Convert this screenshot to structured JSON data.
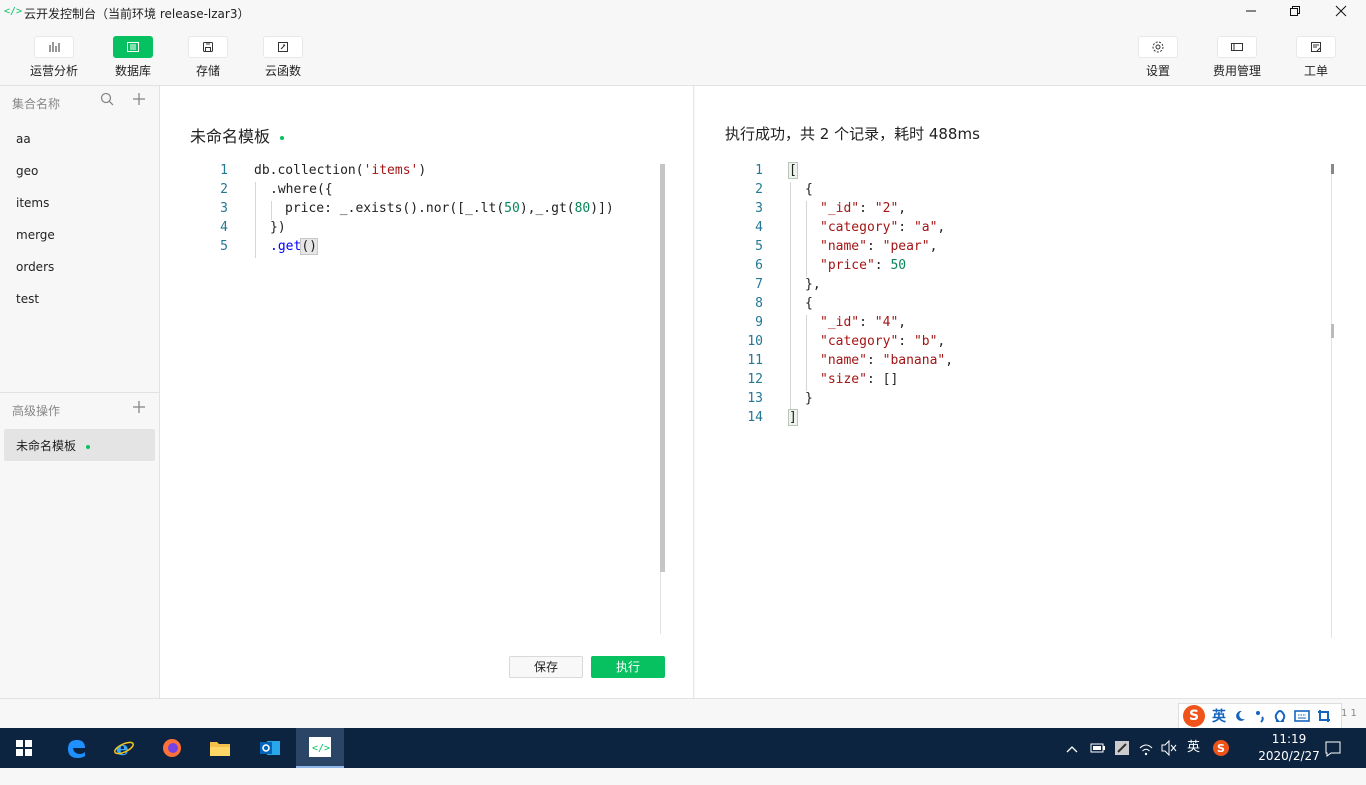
{
  "window": {
    "title": "云开发控制台（当前环境 release-lzar3）",
    "app_icon": "</>"
  },
  "toolbar": {
    "left": [
      {
        "label": "运营分析",
        "icon": "bar-chart-icon"
      },
      {
        "label": "数据库",
        "icon": "database-icon",
        "active": true
      },
      {
        "label": "存储",
        "icon": "storage-icon"
      },
      {
        "label": "云函数",
        "icon": "cloud-function-icon"
      }
    ],
    "right": [
      {
        "label": "设置",
        "icon": "gear-icon"
      },
      {
        "label": "费用管理",
        "icon": "billing-icon"
      },
      {
        "label": "工单",
        "icon": "ticket-icon"
      }
    ]
  },
  "sidebar": {
    "collections_header": "集合名称",
    "collections": [
      "aa",
      "geo",
      "items",
      "merge",
      "orders",
      "test"
    ],
    "advanced_header": "高级操作",
    "advanced_items": [
      "未命名模板"
    ]
  },
  "editor": {
    "title": "未命名模板",
    "lines": [
      "1",
      "2",
      "3",
      "4",
      "5"
    ],
    "code": {
      "l1a": "db.collection(",
      "l1s": "'items'",
      "l1b": ")",
      "l2": ".where({",
      "l3a": "price: _.exists().nor([_.lt(",
      "l3n1": "50",
      "l3b": "),_.gt(",
      "l3n2": "80",
      "l3c": ")])",
      "l4": "})",
      "l5a": ".get",
      "l5b": "()"
    },
    "save_label": "保存",
    "run_label": "执行"
  },
  "result": {
    "title": "执行成功，共 2 个记录，耗时 488ms",
    "lines": [
      "1",
      "2",
      "3",
      "4",
      "5",
      "6",
      "7",
      "8",
      "9",
      "10",
      "11",
      "12",
      "13",
      "14"
    ],
    "json": {
      "l1": "[",
      "l2": "{",
      "l3k": "\"_id\"",
      "l3v": "\"2\"",
      "l4k": "\"category\"",
      "l4v": "\"a\"",
      "l5k": "\"name\"",
      "l5v": "\"pear\"",
      "l6k": "\"price\"",
      "l6v": "50",
      "l7": "},",
      "l8": "{",
      "l9k": "\"_id\"",
      "l9v": "\"4\"",
      "l10k": "\"category\"",
      "l10v": "\"b\"",
      "l11k": "\"name\"",
      "l11v": "\"banana\"",
      "l12k": "\"size\"",
      "l12v": "[]",
      "l13": "}",
      "l14": "]",
      "colon": ": ",
      "comma": ","
    }
  },
  "ime": {
    "logo": "S",
    "lang": "英",
    "status_num": "1 1"
  },
  "taskbar": {
    "tray_lang": "英",
    "time": "11:19",
    "date": "2020/2/27"
  },
  "colors": {
    "accent": "#07c160",
    "line_number": "#237893",
    "string": "#a31515",
    "number": "#098658",
    "keyword": "#0000ff",
    "taskbar": "#0d2440"
  }
}
